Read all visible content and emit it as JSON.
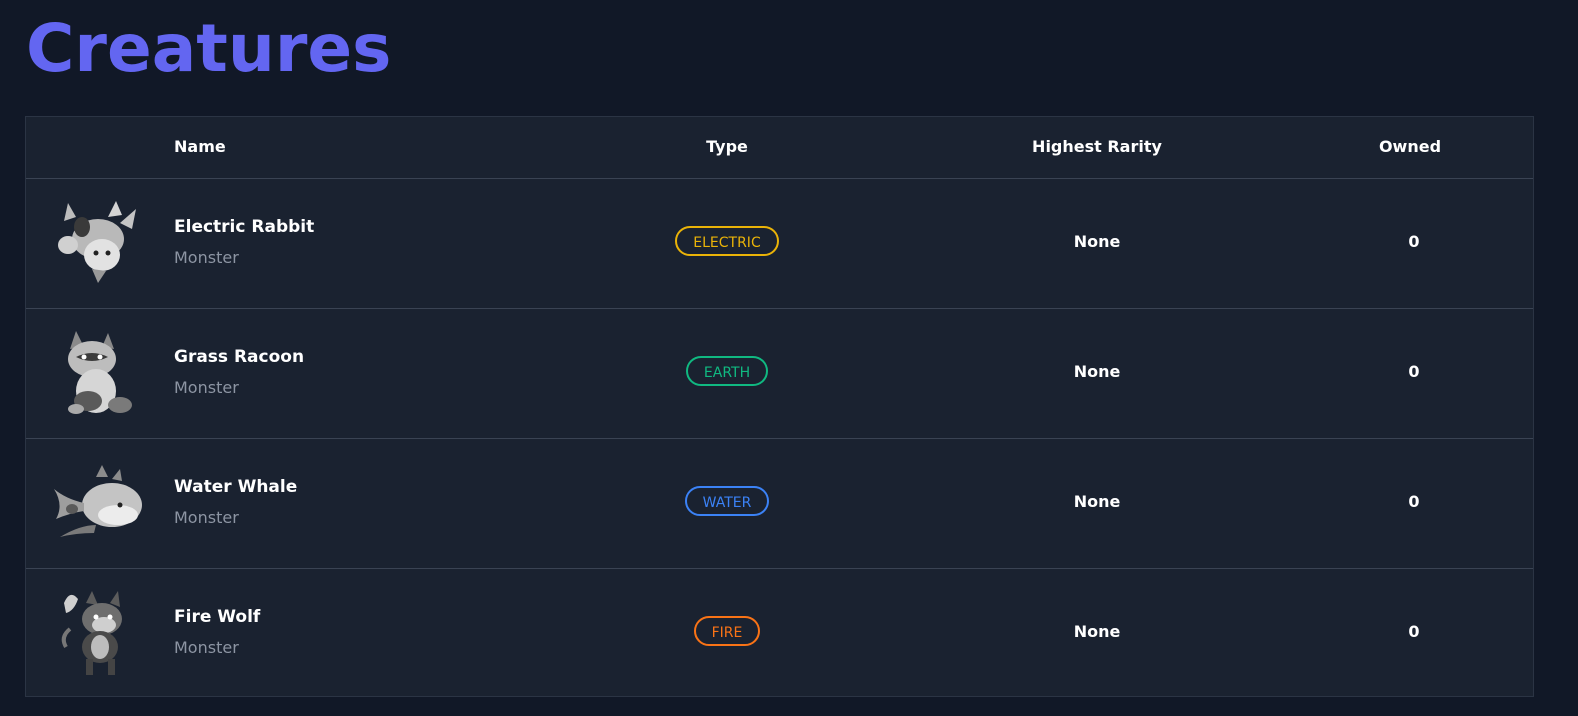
{
  "page": {
    "title": "Creatures"
  },
  "table": {
    "headers": {
      "name": "Name",
      "type": "Type",
      "rarity": "Highest Rarity",
      "owned": "Owned"
    },
    "rows": [
      {
        "name": "Electric Rabbit",
        "category": "Monster",
        "type": "ELECTRIC",
        "type_color": "#eab308",
        "rarity": "None",
        "owned": "0",
        "image_icon": "rabbit-creature-icon"
      },
      {
        "name": "Grass Racoon",
        "category": "Monster",
        "type": "EARTH",
        "type_color": "#10b981",
        "rarity": "None",
        "owned": "0",
        "image_icon": "racoon-creature-icon"
      },
      {
        "name": "Water Whale",
        "category": "Monster",
        "type": "WATER",
        "type_color": "#3b82f6",
        "rarity": "None",
        "owned": "0",
        "image_icon": "whale-creature-icon"
      },
      {
        "name": "Fire Wolf",
        "category": "Monster",
        "type": "FIRE",
        "type_color": "#f97316",
        "rarity": "None",
        "owned": "0",
        "image_icon": "wolf-creature-icon"
      }
    ]
  }
}
